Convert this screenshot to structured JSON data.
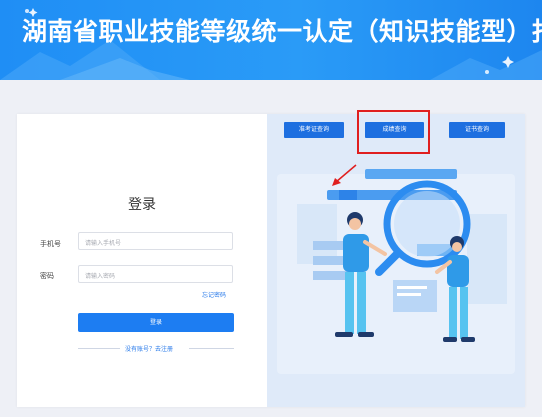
{
  "banner": {
    "title": "湖南省职业技能等级统一认定（知识技能型）报名"
  },
  "login": {
    "title": "登录",
    "phone_label": "手机号",
    "phone_placeholder": "请输入手机号",
    "password_label": "密码",
    "password_placeholder": "请输入密码",
    "forgot_label": "忘记密码",
    "login_button": "登录",
    "register_text": "没有账号？去注册"
  },
  "query_tabs": [
    {
      "label": "准考证查询"
    },
    {
      "label": "成绩查询"
    },
    {
      "label": "证书查询"
    }
  ],
  "colors": {
    "banner": "#1f8ef5",
    "primary_button": "#1d7df2",
    "tab_button": "#1d6fe0",
    "highlight_box": "#e01f1f"
  }
}
